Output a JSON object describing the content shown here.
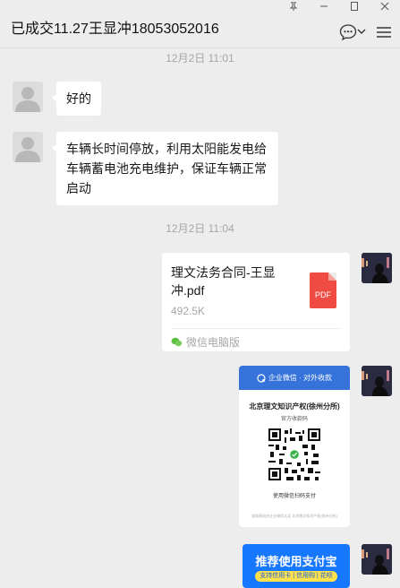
{
  "header": {
    "title": "已成交11.27王显冲18053052016"
  },
  "messages": {
    "ts1": "12月2日 11:01",
    "msg1": "好的",
    "msg2_line1": "车辆长时间停放，利用太阳能发电给",
    "msg2_line2": "车辆蓄电池充电维护，保证车辆正常",
    "msg2_line3": "启动",
    "ts2": "12月2日 11:04"
  },
  "file": {
    "name_line1": "理文法务合同-王显",
    "name_line2": "冲.pdf",
    "size": "492.5K",
    "type_label": "PDF",
    "source": "微信电脑版"
  },
  "qr_card": {
    "header": "企业微信 · 对外收款",
    "org": "北京理文知识产权(徐州分所)",
    "subtitle": "官方收款码",
    "hint": "使用微信扫码支付",
    "footer": "该收款码由企业微信认证 北京理文知识产权(徐州分所)"
  },
  "alipay_card": {
    "title": "推荐使用支付宝",
    "tag": "支持信用卡 | 信用购 | 花呗"
  },
  "colors": {
    "background": "#ededed",
    "bubble": "#ffffff",
    "timestamp": "#a6a6a6",
    "pdf_red": "#f04b42",
    "qr_blue": "#3572d9",
    "alipay_blue": "#1677ff"
  }
}
